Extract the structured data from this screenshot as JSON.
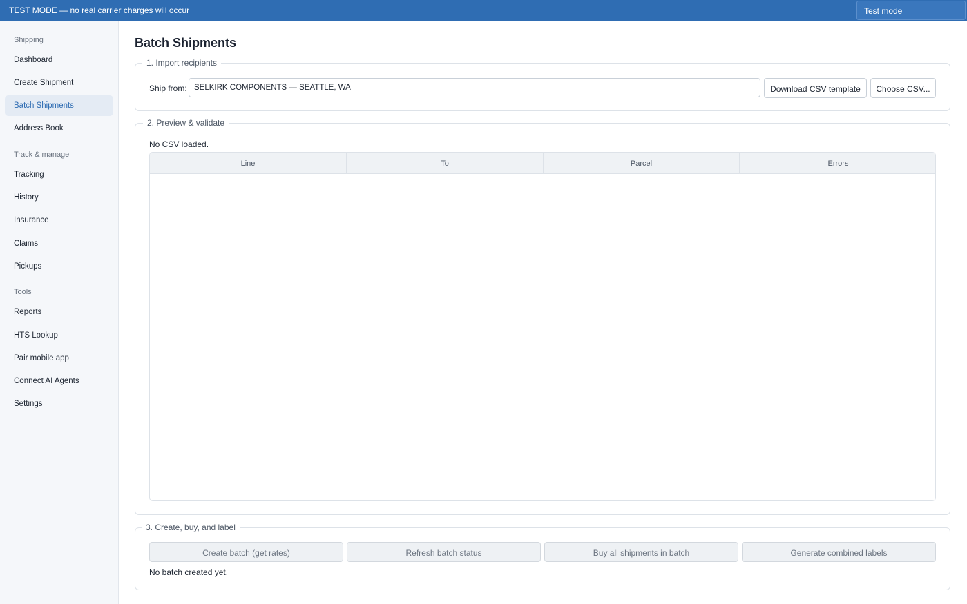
{
  "banner": {
    "text": "TEST MODE — no real carrier charges will occur",
    "mode_selected": "Test mode",
    "color": "#2f6db3"
  },
  "sidebar": {
    "sections": [
      {
        "label": "Shipping"
      },
      {
        "label": "Track & manage"
      },
      {
        "label": "Tools"
      }
    ],
    "items": [
      {
        "label": "Dashboard"
      },
      {
        "label": "Create Shipment"
      },
      {
        "label": "Batch Shipments",
        "active": true
      },
      {
        "label": "Address Book"
      },
      {
        "label": "Tracking"
      },
      {
        "label": "History"
      },
      {
        "label": "Insurance"
      },
      {
        "label": "Claims"
      },
      {
        "label": "Pickups"
      },
      {
        "label": "Reports"
      },
      {
        "label": "HTS Lookup"
      },
      {
        "label": "Pair mobile app"
      },
      {
        "label": "Connect AI Agents"
      },
      {
        "label": "Settings"
      }
    ]
  },
  "page": {
    "title": "Batch Shipments"
  },
  "import": {
    "legend": "1. Import recipients",
    "ship_from_label": "Ship from:",
    "ship_from_value": "SELKIRK COMPONENTS — SEATTLE, WA",
    "download_template_label": "Download CSV template",
    "choose_csv_label": "Choose CSV..."
  },
  "preview": {
    "legend": "2. Preview & validate",
    "status": "No CSV loaded.",
    "columns": [
      "Line",
      "To",
      "Parcel",
      "Errors"
    ],
    "rows": []
  },
  "create": {
    "legend": "3. Create, buy, and label",
    "create_batch_label": "Create batch (get rates)",
    "refresh_label": "Refresh batch status",
    "buy_all_label": "Buy all shipments in batch",
    "generate_labels_label": "Generate combined labels",
    "status": "No batch created yet."
  }
}
